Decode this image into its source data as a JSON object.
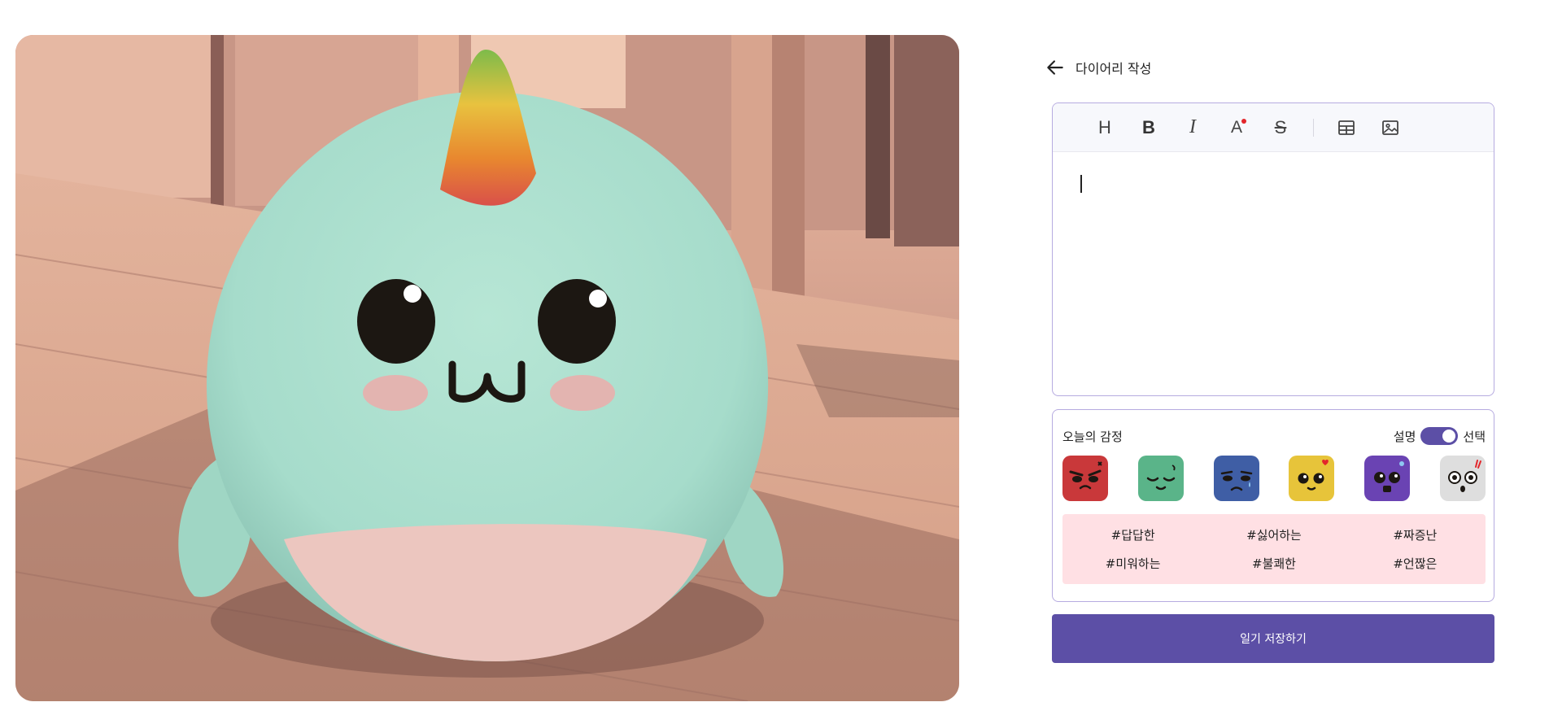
{
  "header": {
    "title": "다이어리 작성"
  },
  "editor": {
    "toolbar": [
      {
        "name": "heading",
        "glyph": "H"
      },
      {
        "name": "bold",
        "glyph": "B"
      },
      {
        "name": "italic",
        "glyph": "I"
      },
      {
        "name": "text-color",
        "glyph": "A"
      },
      {
        "name": "strikethrough",
        "glyph": "S"
      }
    ],
    "body_text": ""
  },
  "emotion": {
    "title": "오늘의 감정",
    "toggle_left": "설명",
    "toggle_right": "선택",
    "faces": [
      {
        "name": "angry",
        "color": "#c9383a"
      },
      {
        "name": "content",
        "color": "#5ab489"
      },
      {
        "name": "sad",
        "color": "#3f5ea5"
      },
      {
        "name": "love",
        "color": "#e7c43a"
      },
      {
        "name": "anxious",
        "color": "#6a43b3"
      },
      {
        "name": "surprised",
        "color": "#dedede"
      }
    ],
    "tags": [
      "#답답한",
      "#싫어하는",
      "#짜증난",
      "#미워하는",
      "#불쾌한",
      "#언짢은"
    ],
    "tag_bg": "#ffe0e4"
  },
  "save_button": {
    "label": "일기 저장하기",
    "color": "#5c4fa6"
  }
}
